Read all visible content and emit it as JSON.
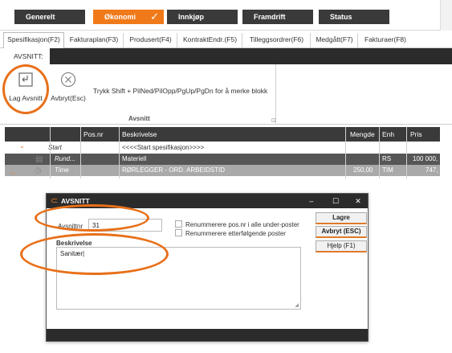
{
  "modules": [
    {
      "label": "Generelt",
      "active": false
    },
    {
      "label": "Økonomi",
      "active": true
    },
    {
      "label": "Innkjøp",
      "active": false
    },
    {
      "label": "Framdrift",
      "active": false
    },
    {
      "label": "Status",
      "active": false
    }
  ],
  "tabs": [
    "Spesifikasjon(F2)",
    "Fakturaplan(F3)",
    "Produsert(F4)",
    "KontraktEndr.(F5)",
    "Tilleggsordrer(F6)",
    "Medgått(F7)",
    "Fakturaer(F8)"
  ],
  "ribbon": {
    "section_label": "AVSNITT:",
    "lag_avsnitt": "Lag Avsnitt",
    "avbryt": "Avbryt(Esc)",
    "hint": "Trykk Shift + PilNed/PilOpp/PgUp/PgDn for å merke blokk",
    "group_label": "Avsnitt"
  },
  "grid": {
    "headers": [
      "Pos.nr",
      "Beskrivelse",
      "Mengde",
      "Enh",
      "Pris"
    ],
    "rows": [
      {
        "type": "Start",
        "beskrivelse": "<<<<Start spesifikasjon>>>>",
        "mengde": "",
        "enh": "",
        "pris": ""
      },
      {
        "type": "Rund...",
        "beskrivelse": "Materiell",
        "mengde": "",
        "enh": "RS",
        "pris": "100 000,"
      },
      {
        "type": "Time",
        "beskrivelse": "RØRLEGGER - ORD. ARBEIDSTID",
        "mengde": "250,00",
        "enh": "TIM",
        "pris": "747,"
      }
    ]
  },
  "dialog": {
    "title": "AVSNITT",
    "avsnittnr_label": "Avsnittnr",
    "avsnittnr_value": "31",
    "renummerere_under": "Renummerere pos.nr i alle under-poster",
    "renummerere_etter": "Renummerere etterfølgende poster",
    "beskrivelse_label": "Beskrivelse",
    "beskrivelse_value": "Sanitær",
    "lagre": "Lagre",
    "avbryt": "Avbryt (ESC)",
    "hjelp": "Hjelp (F1)"
  },
  "colors": {
    "accent": "#f07a1a",
    "dark": "#2b2b2b"
  }
}
